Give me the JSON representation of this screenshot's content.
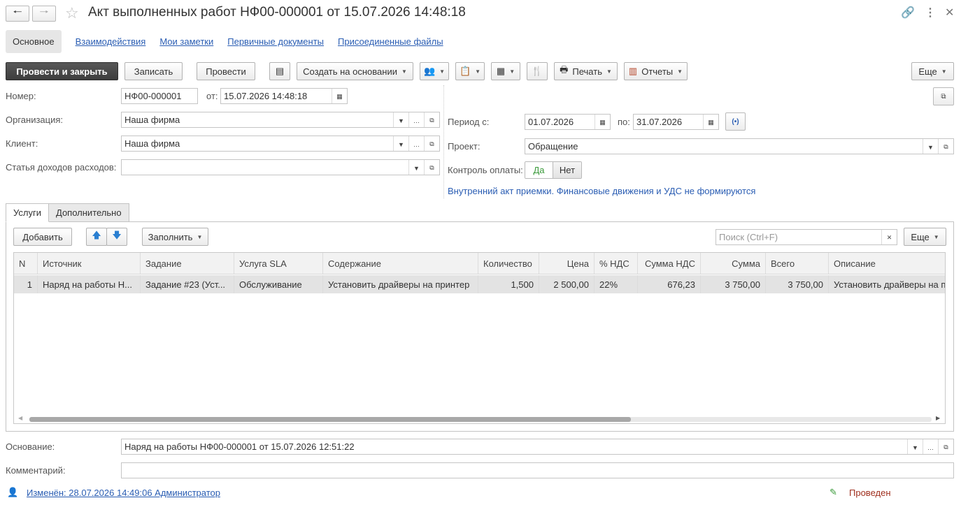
{
  "window": {
    "title": "Акт выполненных работ НФ00-000001 от 15.07.2026 14:48:18"
  },
  "nav_tabs": {
    "active": "Основное",
    "links": [
      "Взаимодействия",
      "Мои заметки",
      "Первичные документы",
      "Присоединенные файлы"
    ]
  },
  "toolbar": {
    "post_close": "Провести и закрыть",
    "write": "Записать",
    "post": "Провести",
    "create_based": "Создать на основании",
    "print": "Печать",
    "reports": "Отчеты",
    "more": "Еще"
  },
  "form": {
    "number_label": "Номер:",
    "number_value": "НФ00-000001",
    "from_label": "от:",
    "date_value": "15.07.2026 14:48:18",
    "org_label": "Организация:",
    "org_value": "Наша фирма",
    "client_label": "Клиент:",
    "client_value": "Наша фирма",
    "article_label": "Статья доходов расходов:",
    "article_value": "",
    "period_label": "Период с:",
    "period_from": "01.07.2026",
    "to_label": "по:",
    "period_to": "31.07.2026",
    "project_label": "Проект:",
    "project_value": "Обращение",
    "payment_label": "Контроль оплаты:",
    "yes": "Да",
    "no": "Нет",
    "info": "Внутренний акт приемки. Финансовые движения и УДС не формируются"
  },
  "tabs": [
    "Услуги",
    "Дополнительно"
  ],
  "grid_toolbar": {
    "add": "Добавить",
    "fill": "Заполнить",
    "search_placeholder": "Поиск (Ctrl+F)",
    "more": "Еще"
  },
  "table": {
    "columns": [
      "N",
      "Источник",
      "Задание",
      "Услуга SLA",
      "Содержание",
      "Количество",
      "Цена",
      "% НДС",
      "Сумма НДС",
      "Сумма",
      "Всего",
      "Описание"
    ],
    "rows": [
      [
        "1",
        "Наряд на работы Н...",
        "Задание #23 (Уст...",
        "Обслуживание",
        "Установить драйверы на принтер",
        "1,500",
        "2 500,00",
        "22%",
        "676,23",
        "3 750,00",
        "3 750,00",
        "Установить драйверы на п"
      ]
    ]
  },
  "bottom": {
    "basis_label": "Основание:",
    "basis_value": "Наряд на работы НФ00-000001 от 15.07.2026 12:51:22",
    "comment_label": "Комментарий:",
    "comment_value": "",
    "changed": "Изменён: 28.07.2026 14:49:06 Администратор",
    "status": "Проведен"
  },
  "colors": {
    "link": "#2a5db3",
    "status": "#a0301f",
    "accent_green": "#3a9a3a"
  }
}
